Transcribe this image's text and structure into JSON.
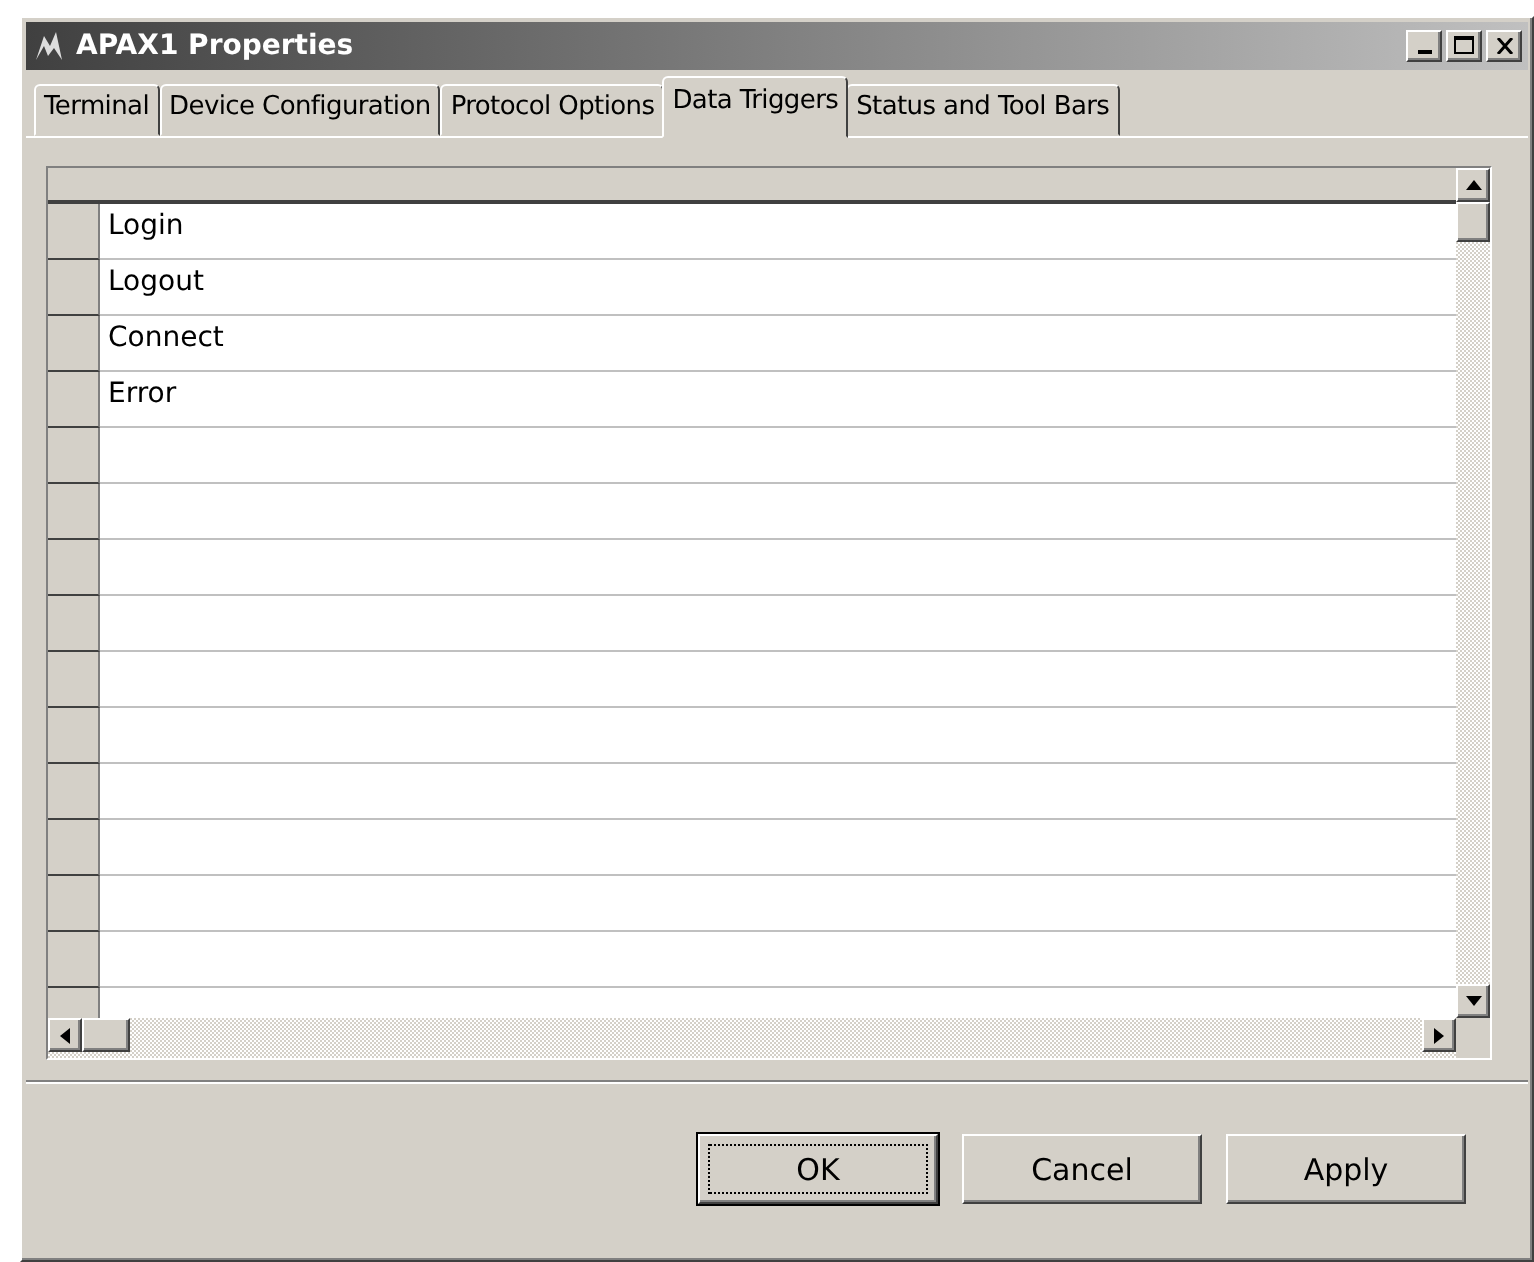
{
  "window": {
    "title": "APAX1 Properties"
  },
  "tabs": [
    {
      "label": "Terminal",
      "selected": false
    },
    {
      "label": "Device Configuration",
      "selected": false
    },
    {
      "label": "Protocol Options",
      "selected": false
    },
    {
      "label": "Data Triggers",
      "selected": true
    },
    {
      "label": "Status and Tool Bars",
      "selected": false
    }
  ],
  "grid": {
    "rows": [
      {
        "label": "Login"
      },
      {
        "label": "Logout"
      },
      {
        "label": "Connect"
      },
      {
        "label": "Error"
      }
    ]
  },
  "buttons": [
    {
      "label": "OK",
      "default": true
    },
    {
      "label": "Cancel",
      "default": false
    },
    {
      "label": "Apply",
      "default": false
    }
  ]
}
